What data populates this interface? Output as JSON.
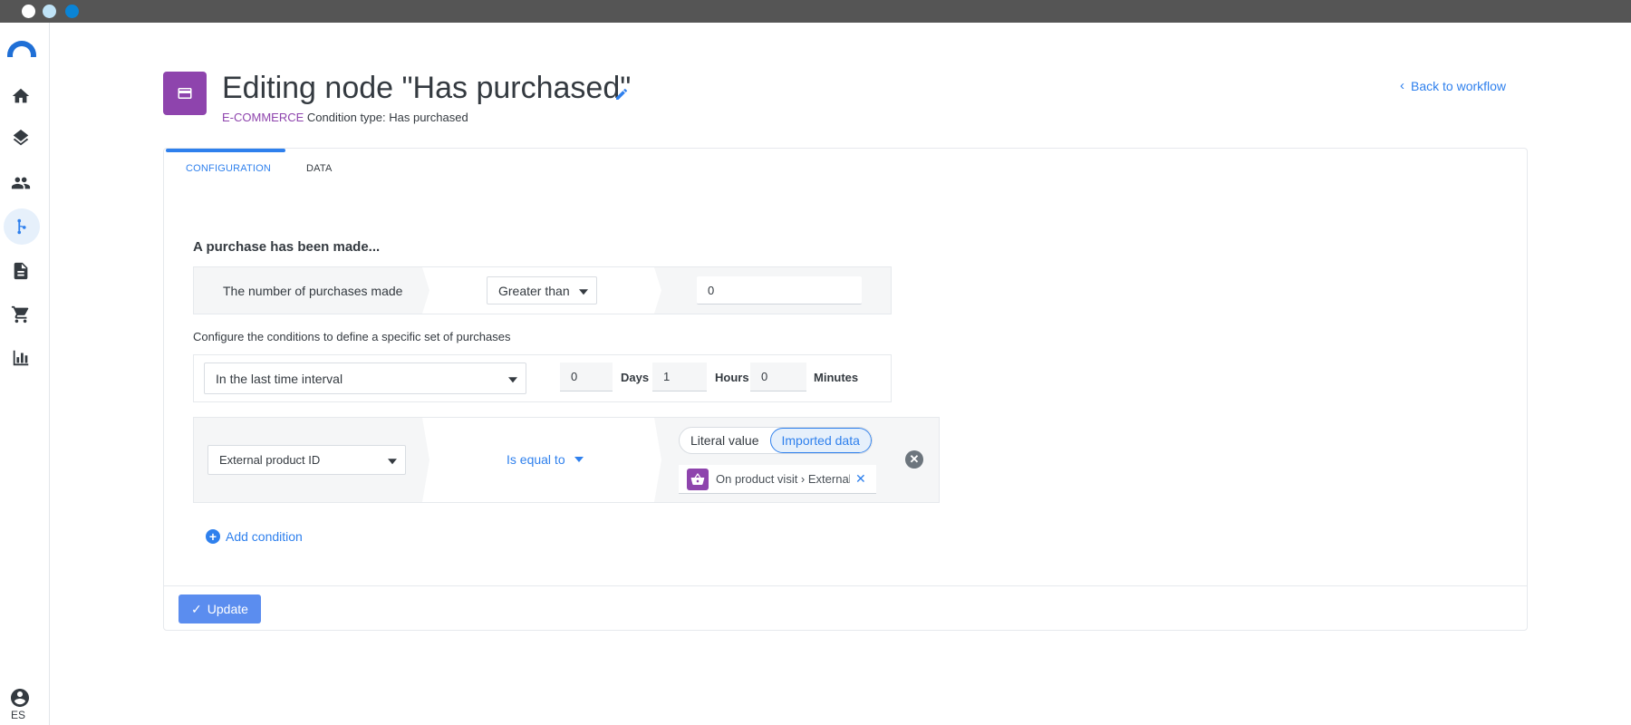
{
  "header": {
    "title": "Editing node \"Has purchased\"",
    "category": "E-COMMERCE",
    "condition_type": "Condition type: Has purchased",
    "back_label": "Back to workflow"
  },
  "sidebar": {
    "items": [
      {
        "icon": "home-icon"
      },
      {
        "icon": "layers-icon"
      },
      {
        "icon": "users-icon"
      },
      {
        "icon": "workflow-icon",
        "active": true
      },
      {
        "icon": "document-icon"
      },
      {
        "icon": "cart-icon"
      },
      {
        "icon": "bar-chart-icon"
      }
    ],
    "language": "ES"
  },
  "tabs": [
    {
      "label": "CONFIGURATION",
      "active": true
    },
    {
      "label": "DATA",
      "active": false
    }
  ],
  "section_title": "A purchase has been made...",
  "purchases_row": {
    "label": "The number of purchases made",
    "operator": "Greater than",
    "value": "0"
  },
  "config_text": "Configure the conditions to define a specific set of purchases",
  "time_row": {
    "interval": "In the last time interval",
    "days_value": "0",
    "days_label": "Days",
    "hours_value": "1",
    "hours_label": "Hours",
    "minutes_value": "0",
    "minutes_label": "Minutes"
  },
  "condition_row": {
    "field": "External product ID",
    "operator": "Is equal to",
    "literal_label": "Literal value",
    "imported_label": "Imported data",
    "imported_active": true,
    "chip_text": "On product visit › External product ID"
  },
  "add_condition_label": "Add condition",
  "update_label": "Update",
  "colors": {
    "accent": "#2f80ed",
    "category_purple": "#8e44ad",
    "update_button": "#5b8def"
  }
}
